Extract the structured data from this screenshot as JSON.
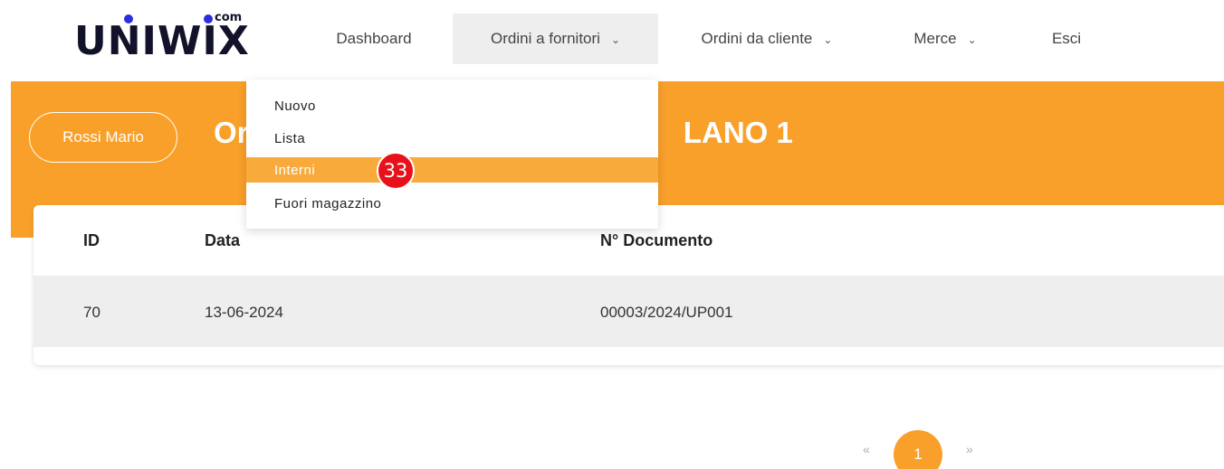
{
  "brand": {
    "name": "UNIWIX",
    "suffix": "com"
  },
  "nav": [
    {
      "label": "Dashboard",
      "has_chevron": false
    },
    {
      "label": "Ordini a fornitori",
      "has_chevron": true,
      "active": true
    },
    {
      "label": "Ordini da cliente",
      "has_chevron": true
    },
    {
      "label": "Merce",
      "has_chevron": true
    },
    {
      "label": "Esci",
      "has_chevron": false
    }
  ],
  "chevron_glyph": "⌄",
  "user": {
    "name": "Rossi Mario"
  },
  "page": {
    "title_visible_left": "Or",
    "title_visible_right": "LANO 1"
  },
  "dropdown": {
    "items": [
      {
        "label": "Nuovo"
      },
      {
        "label": "Lista"
      },
      {
        "label": "Interni",
        "highlighted": true
      },
      {
        "label": "Fuori magazzino"
      }
    ]
  },
  "badge": {
    "count": "33",
    "color": "#e8101a"
  },
  "table": {
    "columns": [
      "ID",
      "Data",
      "N° Documento"
    ],
    "rows": [
      {
        "id": "70",
        "date": "13-06-2024",
        "doc": "00003/2024/UP001"
      }
    ]
  },
  "pagination": {
    "prev": "«",
    "current": "1",
    "next": "»"
  },
  "colors": {
    "accent": "#f9a02a",
    "highlight": "#f8ab3b",
    "row_bg": "#eeeeee"
  }
}
